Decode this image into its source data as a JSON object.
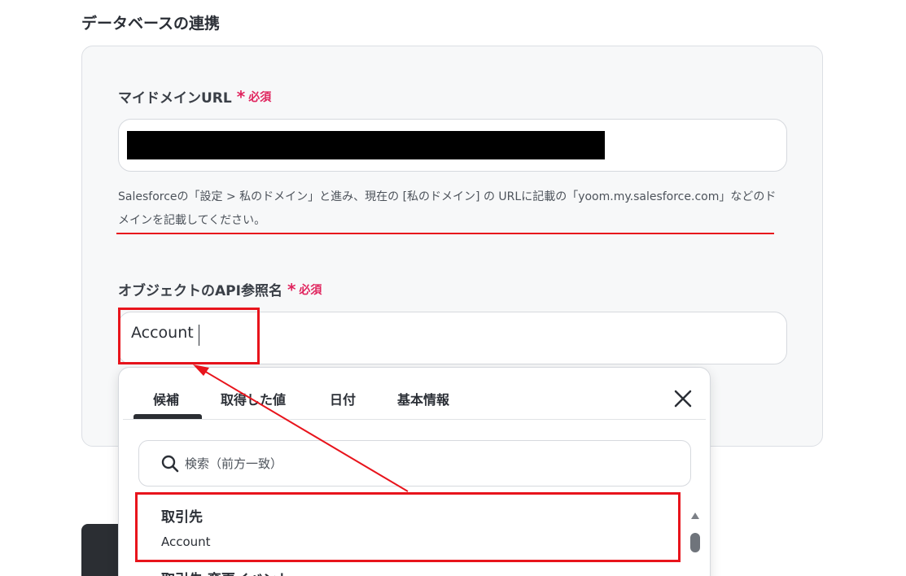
{
  "section": {
    "title": "データベースの連携"
  },
  "domain_field": {
    "label": "マイドメインURL",
    "required_star": "*",
    "required_text": "必須",
    "help_text": "Salesforceの「設定 > 私のドメイン」と進み、現在の [私のドメイン] の URLに記載の「yoom.my.salesforce.com」などのドメインを記載してください。"
  },
  "object_field": {
    "label": "オブジェクトのAPI参照名",
    "required_star": "*",
    "required_text": "必須",
    "value": "Account"
  },
  "dropdown": {
    "tabs": [
      {
        "label": "候補",
        "active": true
      },
      {
        "label": "取得した値"
      },
      {
        "label": "日付"
      },
      {
        "label": "基本情報"
      }
    ],
    "search_placeholder": "検索（前方一致）",
    "options": [
      {
        "title": "取引先",
        "sub": "Account"
      },
      {
        "title": "取引先 変更イベント"
      }
    ]
  },
  "colors": {
    "accent_red": "#e8141c",
    "required_pink": "#e0245e",
    "card_bg": "#f7f8f9"
  },
  "icons": [
    "search-icon",
    "close-icon",
    "scroll-up-icon"
  ]
}
